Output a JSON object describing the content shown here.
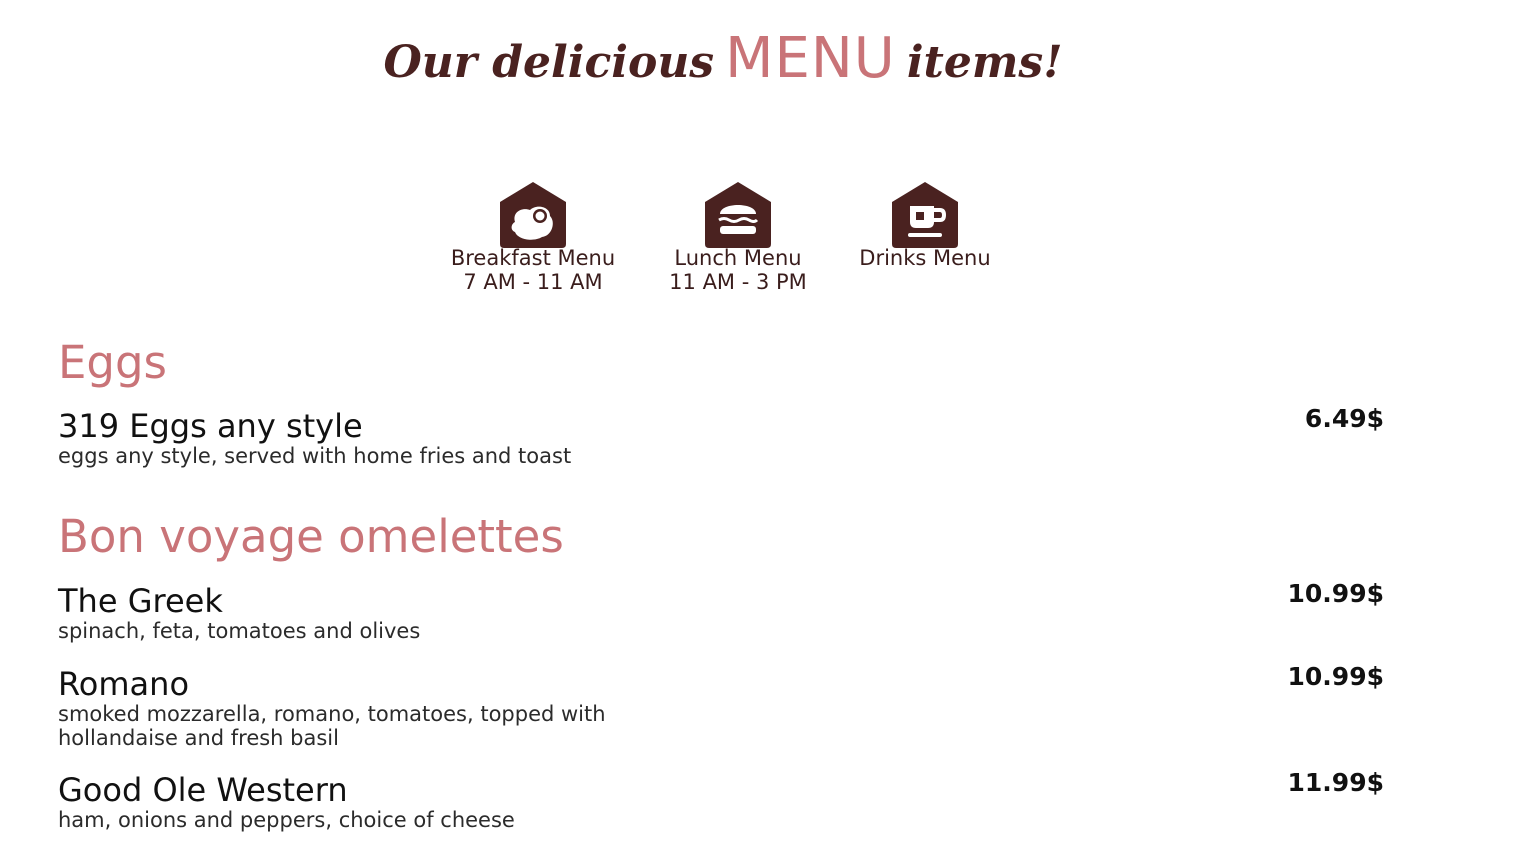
{
  "header": {
    "title_before": "Our delicious",
    "title_highlight": "MENU",
    "title_after": "items!"
  },
  "nav": [
    {
      "label": "Breakfast Menu",
      "hours": "7 AM - 11 AM",
      "icon": "egg-icon"
    },
    {
      "label": "Lunch Menu",
      "hours": "11 AM - 3 PM",
      "icon": "burger-icon"
    },
    {
      "label": "Drinks Menu",
      "hours": "",
      "icon": "coffee-icon"
    }
  ],
  "sections": [
    {
      "title": "Eggs",
      "items": [
        {
          "name": "319 Eggs any style",
          "description": "eggs any style, served with home fries and toast",
          "price": "6.49$"
        }
      ]
    },
    {
      "title": "Bon voyage omelettes",
      "items": [
        {
          "name": "The Greek",
          "description": "spinach, feta, tomatoes and olives",
          "price": "10.99$"
        },
        {
          "name": "Romano",
          "description": "smoked mozzarella, romano, tomatoes, topped with hollandaise and fresh basil",
          "price": "10.99$"
        },
        {
          "name": "Good Ole Western",
          "description": "ham, onions and peppers, choice of cheese",
          "price": "11.99$"
        }
      ]
    }
  ],
  "colors": {
    "brand_dark": "#4a2220",
    "accent_pink": "#c97478",
    "text": "#111111"
  }
}
